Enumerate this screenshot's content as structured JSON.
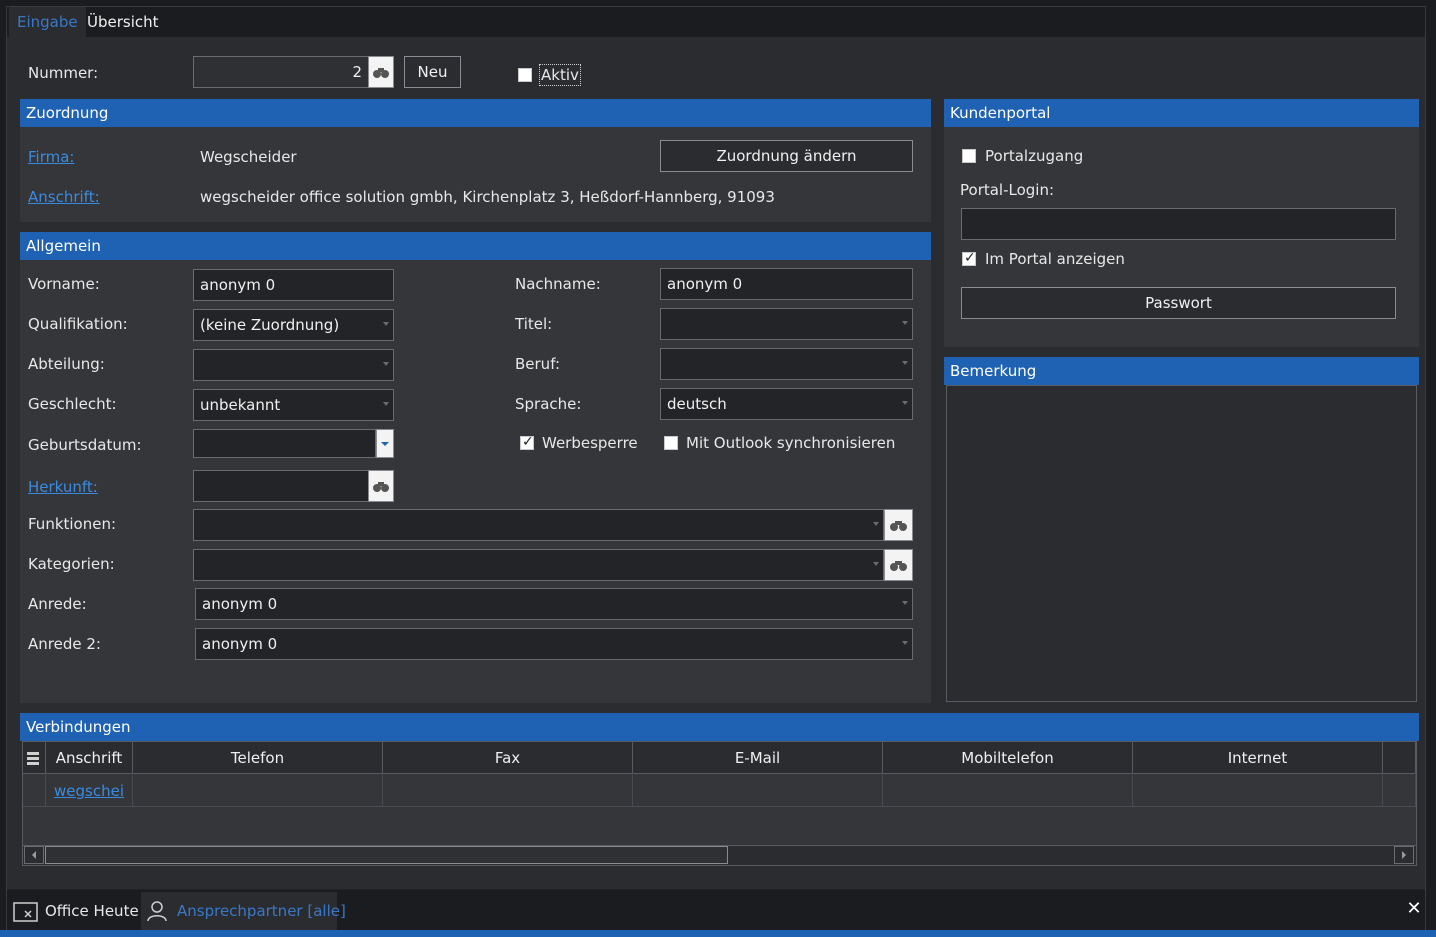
{
  "tabs": [
    {
      "label": "Eingabe",
      "active": true
    },
    {
      "label": "Übersicht",
      "active": false
    }
  ],
  "top": {
    "nummer_label": "Nummer:",
    "nummer_value": "2",
    "neu_label": "Neu",
    "aktiv_label": "Aktiv",
    "aktiv_checked": false
  },
  "zuordnung": {
    "title": "Zuordnung",
    "firma_label": "Firma:",
    "firma_value": "Wegscheider",
    "anschrift_label": "Anschrift:",
    "anschrift_value": "wegscheider office solution gmbh, Kirchenplatz 3, Heßdorf-Hannberg, 91093",
    "change_button": "Zuordnung ändern"
  },
  "allgemein": {
    "title": "Allgemein",
    "vorname_label": "Vorname:",
    "vorname_value": "anonym 0",
    "nachname_label": "Nachname:",
    "nachname_value": "anonym 0",
    "qualifikation_label": "Qualifikation:",
    "qualifikation_value": "(keine Zuordnung)",
    "titel_label": "Titel:",
    "titel_value": "",
    "abteilung_label": "Abteilung:",
    "abteilung_value": "",
    "beruf_label": "Beruf:",
    "beruf_value": "",
    "geschlecht_label": "Geschlecht:",
    "geschlecht_value": "unbekannt",
    "sprache_label": "Sprache:",
    "sprache_value": "deutsch",
    "geburtsdatum_label": "Geburtsdatum:",
    "geburtsdatum_value": "",
    "werbesperre_label": "Werbesperre",
    "werbesperre_checked": true,
    "outlook_label": "Mit Outlook synchronisieren",
    "outlook_checked": false,
    "herkunft_label": "Herkunft:",
    "herkunft_value": "",
    "funktionen_label": "Funktionen:",
    "funktionen_value": "",
    "kategorien_label": "Kategorien:",
    "kategorien_value": "",
    "anrede_label": "Anrede:",
    "anrede_value": "anonym 0",
    "anrede2_label": "Anrede 2:",
    "anrede2_value": "anonym 0"
  },
  "kundenportal": {
    "title": "Kundenportal",
    "portalzugang_label": "Portalzugang",
    "portalzugang_checked": false,
    "login_label": "Portal-Login:",
    "login_value": "",
    "im_portal_label": "Im Portal anzeigen",
    "im_portal_checked": true,
    "passwort_button": "Passwort"
  },
  "bemerkung": {
    "title": "Bemerkung",
    "text": ""
  },
  "verbindungen": {
    "title": "Verbindungen",
    "columns": [
      "Anschrift",
      "Telefon",
      "Fax",
      "E-Mail",
      "Mobiltelefon",
      "Internet"
    ],
    "rows": [
      {
        "anschrift": "wegschei",
        "telefon": "",
        "fax": "",
        "email": "",
        "mobil": "",
        "internet": ""
      }
    ]
  },
  "bottom_tabs": [
    {
      "label": "Office Heute",
      "icon": "close-window-icon"
    },
    {
      "label": "Ansprechpartner [alle]",
      "icon": "person-icon"
    }
  ],
  "colors": {
    "accent": "#1f62b3",
    "link": "#3a8be0"
  }
}
